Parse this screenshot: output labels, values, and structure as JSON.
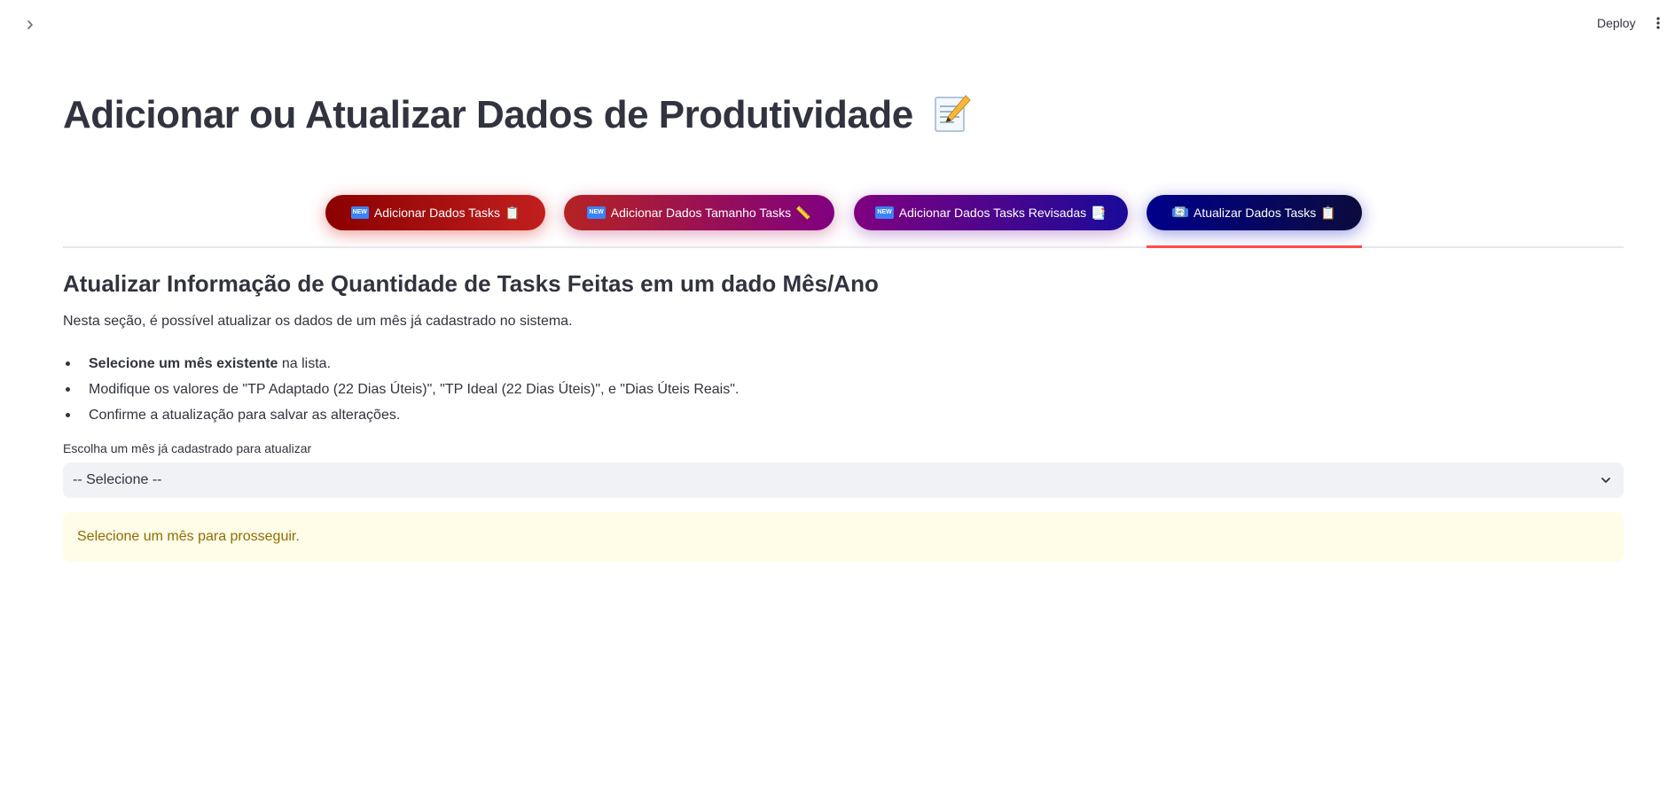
{
  "header": {
    "deploy_label": "Deploy",
    "sidebar_toggle_icon": "chevron-right-icon",
    "menu_icon": "kebab-menu-icon"
  },
  "page": {
    "title": "Adicionar ou Atualizar Dados de Produtividade",
    "title_icon": "memo-emoji-icon"
  },
  "tabs": [
    {
      "tag": "NEW",
      "label": "Adicionar Dados Tasks",
      "trailing_icon": "clipboard-emoji"
    },
    {
      "tag": "NEW",
      "label": "Adicionar Dados Tamanho Tasks",
      "trailing_icon": "ruler-emoji"
    },
    {
      "tag": "NEW",
      "label": "Adicionar Dados Tasks Revisadas",
      "trailing_icon": "page-emoji"
    },
    {
      "tag": "🔄",
      "label": "Atualizar Dados Tasks",
      "trailing_icon": "clipboard-emoji",
      "active": true
    }
  ],
  "section": {
    "title": "Atualizar Informação de Quantidade de Tasks Feitas em um dado Mês/Ano",
    "intro": "Nesta seção, é possível atualizar os dados de um mês já cadastrado no sistema.",
    "bullets": [
      {
        "bold": "Selecione um mês existente",
        "text": " na lista."
      },
      {
        "bold": "",
        "text": "Modifique os valores de \"TP Adaptado (22 Dias Úteis)\", \"TP Ideal (22 Dias Úteis)\", e \"Dias Úteis Reais\"."
      },
      {
        "bold": "",
        "text": "Confirme a atualização para salvar as alterações."
      }
    ]
  },
  "select": {
    "label": "Escolha um mês já cadastrado para atualizar",
    "value": "-- Selecione --"
  },
  "warning": {
    "text": "Selecione um mês para prosseguir."
  },
  "colors": {
    "accent": "#ff4b4b",
    "warning_bg": "#fffce7",
    "warning_text": "#926c05"
  }
}
